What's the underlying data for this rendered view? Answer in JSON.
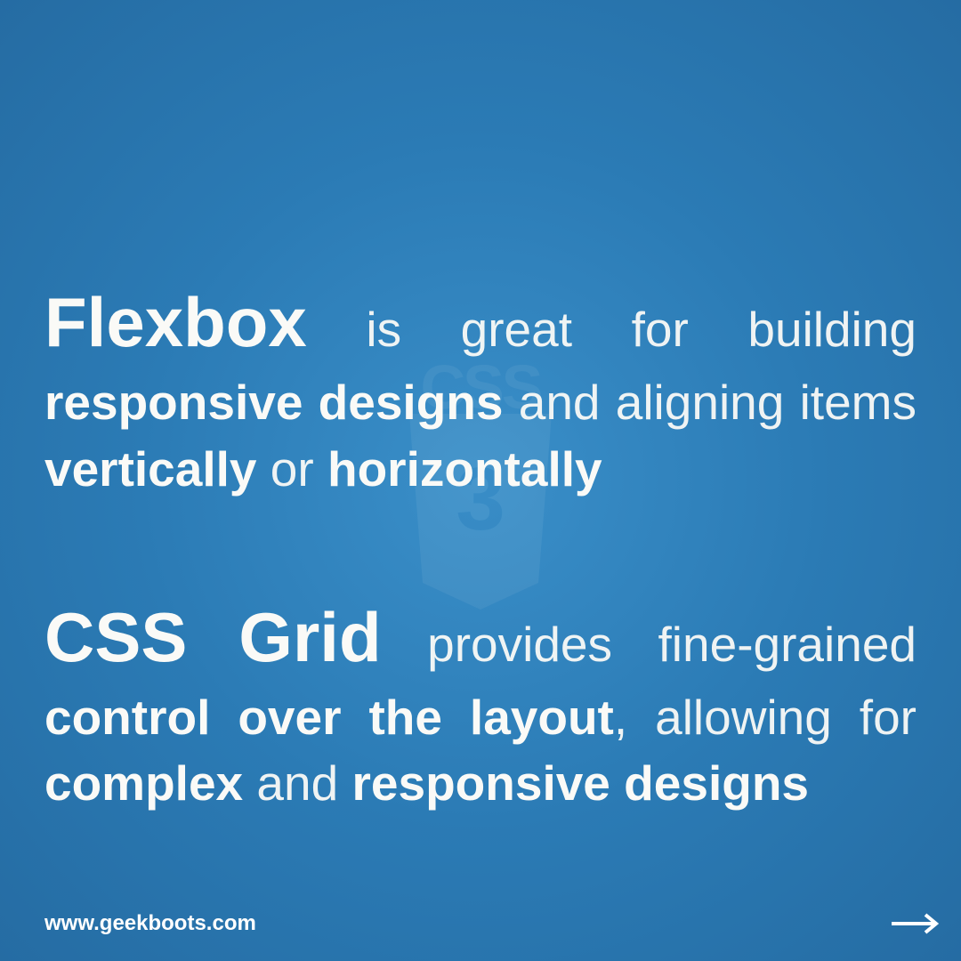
{
  "watermark": {
    "label": "CSS",
    "inner": "3"
  },
  "paragraphs": {
    "p1": {
      "s1": "Flexbox",
      "s2": " is great for building ",
      "s3": "responsive designs",
      "s4": " and aligning items ",
      "s5": "vertically",
      "s6": " or ",
      "s7": "horizontally"
    },
    "p2": {
      "s1": "CSS Grid",
      "s2": " provides fine-grained ",
      "s3": "control over the layout",
      "s4": ", allowing for ",
      "s5": "complex",
      "s6": " and ",
      "s7": "responsive de­signs"
    }
  },
  "footer": {
    "url": "www.geekboots.com"
  }
}
